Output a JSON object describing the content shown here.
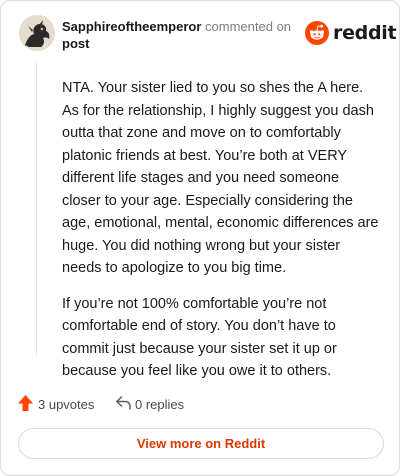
{
  "header": {
    "username": "Sapphireoftheemperor",
    "action_text": "commented on",
    "post_link": "post",
    "brand_name": "reddit"
  },
  "comment": {
    "paragraphs": [
      "NTA. Your sister lied to you so shes the A here. As for the relationship, I highly suggest you dash outta that zone and move on to comfortably platonic friends at best. You’re both at VERY different life stages and you need someone closer to your age. Especially considering the age, emotional, mental, economic differences are huge. You did nothing wrong but your sister needs to apologize to you big time.",
      "If you’re not 100% comfortable you’re not comfortable end of story. You don’t have to commit just because your sister set it up or because you feel like you owe it to others."
    ]
  },
  "footer": {
    "upvotes_label": "3 upvotes",
    "replies_label": "0 replies"
  },
  "view_more_label": "View more on Reddit",
  "colors": {
    "brand": "#ff4500",
    "upvote": "#ff4500",
    "link_text": "#d93a00"
  }
}
